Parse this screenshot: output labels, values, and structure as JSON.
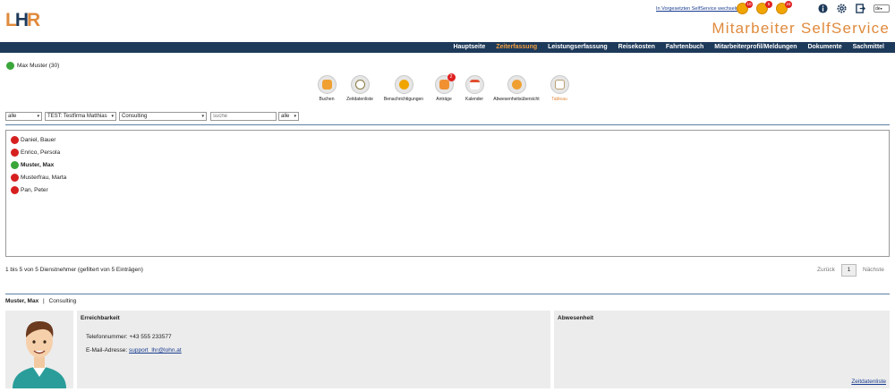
{
  "header": {
    "logo_text": "LHR",
    "switch_link": "In Vorgesetzten SelfService wechseln",
    "notifications": [
      {
        "name": "messages",
        "count": "10"
      },
      {
        "name": "requests",
        "count": "5"
      },
      {
        "name": "tasks",
        "count": "24"
      }
    ],
    "icons": [
      "info-icon",
      "settings-icon",
      "logout-icon"
    ],
    "language": "de",
    "app_title": "Mitarbeiter SelfService"
  },
  "nav": {
    "items": [
      {
        "label": "Hauptseite",
        "active": false
      },
      {
        "label": "Zeiterfassung",
        "active": true
      },
      {
        "label": "Leistungserfassung",
        "active": false
      },
      {
        "label": "Reisekosten",
        "active": false
      },
      {
        "label": "Fahrtenbuch",
        "active": false
      },
      {
        "label": "Mitarbeiterprofil/Meldungen",
        "active": false
      },
      {
        "label": "Dokumente",
        "active": false
      },
      {
        "label": "Sachmittel",
        "active": false
      }
    ]
  },
  "user": {
    "label": "Max Muster (30)"
  },
  "toolbar": {
    "items": [
      {
        "label": "Buchen",
        "icon": "booking-icon",
        "color": "#f0a030",
        "badge": ""
      },
      {
        "label": "Zeitdatenliste",
        "icon": "clock-icon",
        "color": "#c8b060",
        "badge": ""
      },
      {
        "label": "Benachrichtigungen",
        "icon": "notifications-icon",
        "color": "#f0a500",
        "badge": ""
      },
      {
        "label": "Anträge",
        "icon": "requests-icon",
        "color": "#f09030",
        "badge": "2"
      },
      {
        "label": "Kalender",
        "icon": "calendar-icon",
        "color": "#e89040",
        "badge": ""
      },
      {
        "label": "Abwesenheitsübersicht",
        "icon": "absence-overview-icon",
        "color": "#f0a030",
        "badge": ""
      },
      {
        "label": "Tableau",
        "icon": "tableau-icon",
        "color": "#d8c8a0",
        "badge": "",
        "active": true
      }
    ]
  },
  "filters": {
    "status": "alle",
    "company": "TEST: Testfirma Matthias",
    "department": "Consulting",
    "search_placeholder": "suche",
    "scope": "alle"
  },
  "employees": [
    {
      "name": "Daniel, Bauer",
      "status": "red",
      "selected": false
    },
    {
      "name": "Enrico, Persola",
      "status": "red",
      "selected": false
    },
    {
      "name": "Muster, Max",
      "status": "green",
      "selected": true
    },
    {
      "name": "Musterfrau, Marta",
      "status": "red",
      "selected": false
    },
    {
      "name": "Pan, Peter",
      "status": "red",
      "selected": false
    }
  ],
  "paging": {
    "info": "1 bis 5 von 5 Dienstnehmer (gefiltert von 5 Einträgen)",
    "prev": "Zurück",
    "current": "1",
    "next": "Nächste"
  },
  "detail": {
    "name": "Muster, Max",
    "separator": "|",
    "department": "Consulting",
    "reachability_title": "Erreichbarkeit",
    "phone_label": "Telefonnummer:",
    "phone": "+43 555 233577",
    "email_label": "E-Mail-Adresse:",
    "email": "support_lhr@lohn.at",
    "absence_title": "Abwesenheit",
    "link_zeitdaten": "Zeitdatenliste"
  },
  "colors": {
    "accent": "#e08a3c",
    "nav_bg": "#1e3a5a",
    "divider": "#5b7fa3"
  }
}
